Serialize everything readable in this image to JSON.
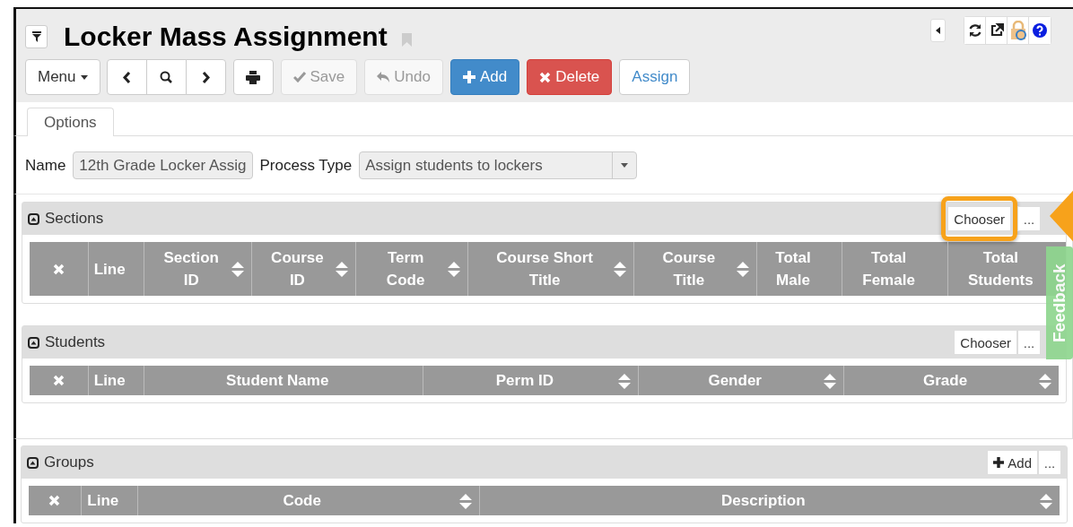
{
  "header": {
    "title": "Locker Mass Assignment"
  },
  "toolbar": {
    "menu": "Menu",
    "buttons": [
      {
        "kind": "save",
        "label": "Save",
        "disabled": true
      },
      {
        "kind": "undo",
        "label": "Undo",
        "disabled": true
      },
      {
        "kind": "add",
        "label": "Add",
        "disabled": false
      },
      {
        "kind": "delete",
        "label": "Delete",
        "disabled": false
      },
      {
        "kind": "assign",
        "label": "Assign",
        "disabled": false
      }
    ]
  },
  "tabs": [
    {
      "label": "Options",
      "selected": true
    }
  ],
  "form": {
    "name_label": "Name",
    "name_value": "12th Grade Locker Assig",
    "process_label": "Process Type",
    "process_value": "Assign students to lockers"
  },
  "panels": [
    {
      "title": "Sections",
      "actions": [
        {
          "kind": "chooser",
          "label": "Chooser",
          "highlighted": true
        },
        {
          "kind": "more",
          "label": "...",
          "highlighted": false
        }
      ],
      "columns": [
        {
          "kind": "remove"
        },
        {
          "kind": "text",
          "label": "Line",
          "sortable": false
        },
        {
          "kind": "text",
          "label": "Section\nID",
          "sortable": true
        },
        {
          "kind": "text",
          "label": "Course\nID",
          "sortable": true
        },
        {
          "kind": "text",
          "label": "Term\nCode",
          "sortable": true
        },
        {
          "kind": "text",
          "label": "Course Short\nTitle",
          "sortable": true
        },
        {
          "kind": "text",
          "label": "Course\nTitle",
          "sortable": true
        },
        {
          "kind": "text",
          "label": "Total\nMale",
          "sortable": false
        },
        {
          "kind": "text",
          "label": "Total\nFemale",
          "sortable": false
        },
        {
          "kind": "text",
          "label": "Total\nStudents",
          "sortable": false
        }
      ]
    },
    {
      "title": "Students",
      "actions": [
        {
          "kind": "chooser",
          "label": "Chooser",
          "highlighted": false
        },
        {
          "kind": "more",
          "label": "...",
          "highlighted": false
        }
      ],
      "columns": [
        {
          "kind": "remove"
        },
        {
          "kind": "text",
          "label": "Line",
          "sortable": false
        },
        {
          "kind": "text",
          "label": "Student Name",
          "sortable": false
        },
        {
          "kind": "text",
          "label": "Perm ID",
          "sortable": true
        },
        {
          "kind": "text",
          "label": "Gender",
          "sortable": true
        },
        {
          "kind": "text",
          "label": "Grade",
          "sortable": true
        }
      ]
    },
    {
      "title": "Groups",
      "actions": [
        {
          "kind": "add",
          "label": "Add",
          "highlighted": false
        },
        {
          "kind": "more",
          "label": "...",
          "highlighted": false
        }
      ],
      "columns": [
        {
          "kind": "remove"
        },
        {
          "kind": "text",
          "label": "Line",
          "sortable": false
        },
        {
          "kind": "text",
          "label": "Code",
          "sortable": true
        },
        {
          "kind": "text",
          "label": "Description",
          "sortable": true
        }
      ]
    }
  ],
  "feedback": "Feedback"
}
